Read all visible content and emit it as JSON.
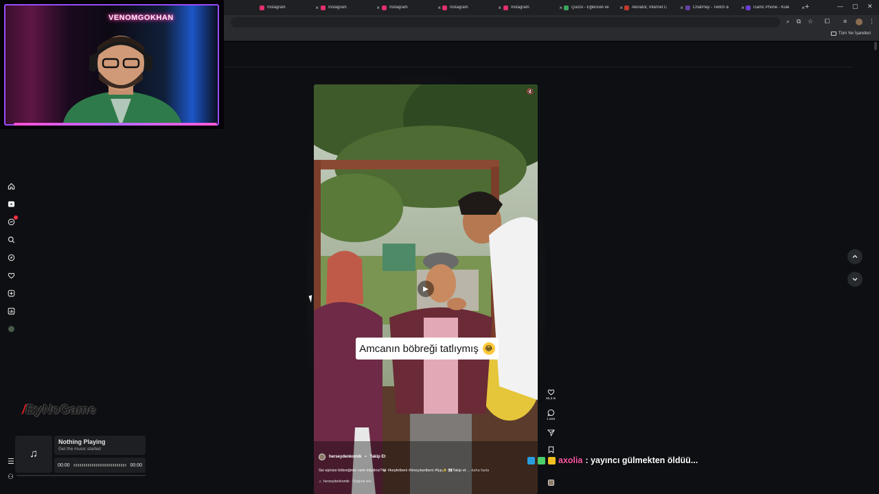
{
  "browser": {
    "tabs": [
      {
        "label": "Instagram",
        "color": "#e1306c"
      },
      {
        "label": "Instagram",
        "color": "#e1306c"
      },
      {
        "label": "Instagram",
        "color": "#e1306c"
      },
      {
        "label": "Instagram",
        "color": "#e1306c"
      },
      {
        "label": "Instagram",
        "color": "#e1306c"
      },
      {
        "label": "Quizoi - Eğlenceli ve",
        "color": "#3ba55c"
      },
      {
        "label": "Akinator, İnternet C",
        "color": "#c0392b"
      },
      {
        "label": "ChatPlay - Twitch & ",
        "color": "#6441a5"
      },
      {
        "label": "Gartic Phone - Kule",
        "color": "#6a3fd6"
      }
    ],
    "new_tab_glyph": "+",
    "bookmarks_label": "Tüm Yer İşaretleri"
  },
  "webcam": {
    "neon_sign": "VENOMGOKHAN"
  },
  "sidebar": {
    "items": [
      "home-icon",
      "reels-icon",
      "messages-icon",
      "search-icon",
      "explore-icon",
      "heart-icon",
      "create-icon",
      "dashboard-icon",
      "profile-avatar"
    ],
    "badge_color": "#ff3040"
  },
  "watermark": {
    "slash": "/",
    "text": "ByNoGame"
  },
  "music": {
    "note_glyph": "♫",
    "title": "Nothing Playing",
    "subtitle": "Get the music started",
    "time_start": "00:00",
    "time_end": "00:00"
  },
  "reel": {
    "subtitle_text": "Amcanın böbreği tatlıymış",
    "subtitle_emoji": "😂",
    "username": "herseydenkomik",
    "follow_sep": "•",
    "follow_label": "Takip Et",
    "caption": "Siz eşinize böbreğinizi verir miydiniz?😂 #keşfetbeni #öneçıkartbeni #fyp✨ 👀Takip et ",
    "caption_more": "... daha fazla",
    "audio": "herseydenkomik · Original ses",
    "likes": "80,9 B",
    "comments": "1.828"
  },
  "chat": {
    "user": "axolia",
    "message": ": yayıncı gülmekten öldüü..."
  }
}
